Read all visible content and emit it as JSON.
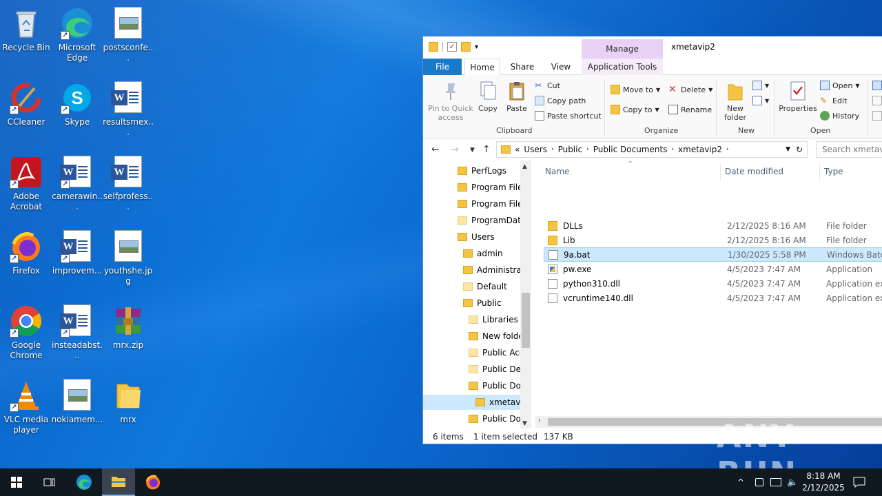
{
  "desktop": {
    "icons": [
      {
        "label": "Recycle Bin"
      },
      {
        "label": "Microsoft Edge"
      },
      {
        "label": "postsconfe..."
      },
      {
        "label": "CCleaner"
      },
      {
        "label": "Skype"
      },
      {
        "label": "resultsmex..."
      },
      {
        "label": "Adobe Acrobat"
      },
      {
        "label": "camerawin..."
      },
      {
        "label": "selfprofess..."
      },
      {
        "label": "Firefox"
      },
      {
        "label": "improvem..."
      },
      {
        "label": "youthshe.jpg"
      },
      {
        "label": "Google Chrome"
      },
      {
        "label": "insteadabst..."
      },
      {
        "label": "mrx.zip"
      },
      {
        "label": "VLC media player"
      },
      {
        "label": "nokiamem..."
      },
      {
        "label": "mrx"
      }
    ]
  },
  "explorer": {
    "title": "xmetavip2",
    "manage_label": "Manage",
    "tabs": {
      "file": "File",
      "home": "Home",
      "share": "Share",
      "view": "View",
      "app_tools": "Application Tools"
    },
    "ribbon": {
      "pin": "Pin to Quick access",
      "copy": "Copy",
      "paste": "Paste",
      "cut": "Cut",
      "copy_path": "Copy path",
      "paste_shortcut": "Paste shortcut",
      "clipboard": "Clipboard",
      "move_to": "Move to",
      "copy_to": "Copy to",
      "delete": "Delete",
      "rename": "Rename",
      "organize": "Organize",
      "new_folder": "New folder",
      "new": "New",
      "properties": "Properties",
      "open": "Open",
      "edit": "Edit",
      "history": "History",
      "open_group": "Open"
    },
    "address": {
      "crumbs": [
        "«",
        "Users",
        "Public",
        "Public Documents",
        "xmetavip2"
      ],
      "search_placeholder": "Search xmetavip"
    },
    "tree": [
      {
        "label": "PerfLogs"
      },
      {
        "label": "Program Files"
      },
      {
        "label": "Program Files"
      },
      {
        "label": "ProgramData"
      },
      {
        "label": "Users"
      },
      {
        "label": "admin"
      },
      {
        "label": "Administrat"
      },
      {
        "label": "Default"
      },
      {
        "label": "Public"
      },
      {
        "label": "Libraries"
      },
      {
        "label": "New folde"
      },
      {
        "label": "Public Acc"
      },
      {
        "label": "Public Des"
      },
      {
        "label": "Public Doc"
      },
      {
        "label": "xmetavip"
      },
      {
        "label": "Public Dov"
      }
    ],
    "columns": {
      "name": "Name",
      "date": "Date modified",
      "type": "Type"
    },
    "files": [
      {
        "name": "DLLs",
        "date": "2/12/2025 8:16 AM",
        "type": "File folder",
        "kind": "folder"
      },
      {
        "name": "Lib",
        "date": "2/12/2025 8:16 AM",
        "type": "File folder",
        "kind": "folder"
      },
      {
        "name": "9a.bat",
        "date": "1/30/2025 5:58 PM",
        "type": "Windows Batch",
        "kind": "file"
      },
      {
        "name": "pw.exe",
        "date": "4/5/2023 7:47 AM",
        "type": "Application",
        "kind": "exe"
      },
      {
        "name": "python310.dll",
        "date": "4/5/2023 7:47 AM",
        "type": "Application exte",
        "kind": "file"
      },
      {
        "name": "vcruntime140.dll",
        "date": "4/5/2023 7:47 AM",
        "type": "Application exte",
        "kind": "file"
      }
    ],
    "status": {
      "items": "6 items",
      "selected": "1 item selected",
      "size": "137 KB"
    }
  },
  "taskbar": {
    "time": "8:18 AM",
    "date": "2/12/2025"
  },
  "watermark": "ANY RUN"
}
